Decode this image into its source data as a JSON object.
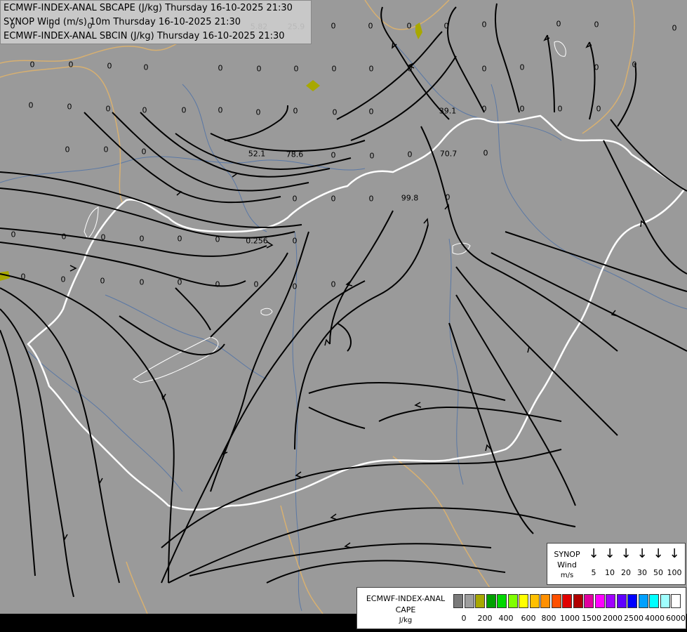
{
  "titles": [
    "ECMWF-INDEX-ANAL SBCAPE (J/kg) Thursday 16-10-2025 21:30",
    "SYNOP Wind (m/s) 10m Thursday 16-10-2025 21:30",
    "ECMWF-INDEX-ANAL SBCIN (J/kg) Thursday 16-10-2025 21:30"
  ],
  "map_values": [
    "0",
    "0",
    "0",
    "0",
    "0",
    "5.82",
    "25.9",
    "0",
    "0",
    "0",
    "0",
    "0",
    "0",
    "0",
    "0",
    "0",
    "0",
    "0",
    "0",
    "0",
    "0",
    "0",
    "0",
    "0",
    "0",
    "0",
    "0",
    "0",
    "0",
    "0",
    "0",
    "0",
    "0",
    "0",
    "0",
    "0",
    "0",
    "39.1",
    "0",
    "0",
    "0",
    "0",
    "0",
    "0",
    "0",
    "52.1",
    "78.6",
    "0",
    "0",
    "0",
    "70.7",
    "0",
    "0",
    "0",
    "0",
    "99.8",
    "0",
    "0",
    "0",
    "0",
    "0",
    "0",
    "0",
    "0.256",
    "0",
    "0",
    "0",
    "0",
    "0",
    "0",
    "0",
    "0",
    "0",
    "0"
  ],
  "synop_legend": {
    "title": "SYNOP",
    "subtitle": "Wind",
    "unit": "m/s",
    "values": [
      "5",
      "10",
      "20",
      "30",
      "50",
      "100"
    ]
  },
  "cape_legend": {
    "title1": "ECMWF-INDEX-ANAL",
    "title2": "CAPE",
    "unit": "J/kg",
    "ticks": [
      "0",
      "200",
      "400",
      "600",
      "800",
      "1000",
      "1500",
      "2000",
      "2500",
      "4000",
      "6000"
    ],
    "colors": [
      "#7a7a7a",
      "#9e9e9e",
      "#a8a800",
      "#00a000",
      "#00d800",
      "#80ff00",
      "#ffff00",
      "#ffc000",
      "#ff9000",
      "#ff5000",
      "#e00000",
      "#b00000",
      "#e000a0",
      "#ff00ff",
      "#a000ff",
      "#6000ff",
      "#0000ff",
      "#00a0ff",
      "#00ffff",
      "#a0ffff",
      "#ffffff"
    ]
  },
  "colors": {
    "background": "#9a9a9a",
    "border_country": "#ffffff",
    "border_region": "#d8b070",
    "river": "#4a6fa8",
    "streamline": "#000000",
    "cape_patch": "#a8a800"
  }
}
